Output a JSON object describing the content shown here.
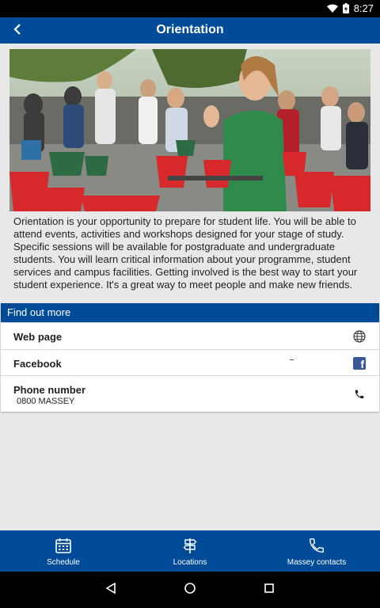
{
  "status_bar": {
    "time": "8:27"
  },
  "header": {
    "title": "Orientation"
  },
  "intro": {
    "text": "Orientation is your opportunity to prepare for student life. You will be able to attend events, activities and workshops designed for your stage of study. Specific sessions will be available for postgraduate and undergraduate students. You will learn critical information about your programme, student services and campus facilities. Getting involved is the best way to start your student experience. It's a great way to meet people and make new friends."
  },
  "find_out_more": {
    "title": "Find out more",
    "items": [
      {
        "label": "Web page",
        "icon": "globe-icon"
      },
      {
        "label": "Facebook",
        "icon": "facebook-icon"
      },
      {
        "label": "Phone number",
        "value": "0800 MASSEY",
        "icon": "phone-icon"
      }
    ]
  },
  "bottom_nav": {
    "items": [
      {
        "label": "Schedule",
        "icon": "calendar-icon"
      },
      {
        "label": "Locations",
        "icon": "signpost-icon"
      },
      {
        "label": "Massey contacts",
        "icon": "phone-icon"
      }
    ]
  },
  "colors": {
    "primary": "#004b97",
    "facebook": "#3b5998",
    "background": "#e8e8e8"
  }
}
